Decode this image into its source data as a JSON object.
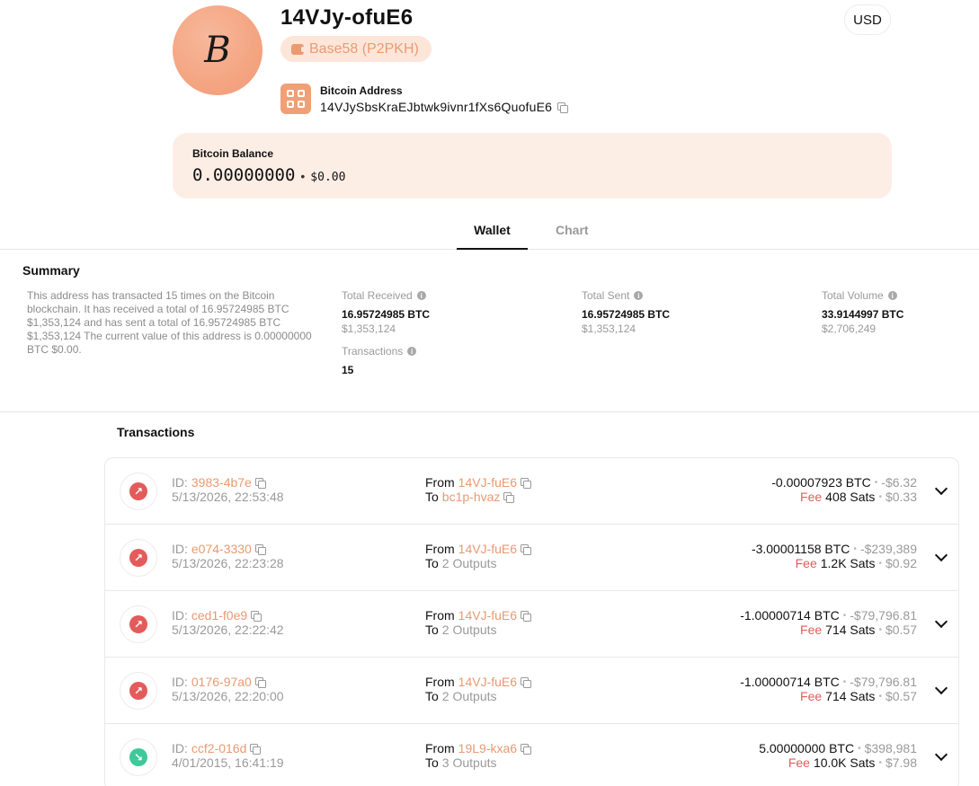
{
  "header": {
    "avatar_symbol": "B",
    "title": "14VJy-ofuE6",
    "address_type": "Base58 (P2PKH)",
    "address_label": "Bitcoin Address",
    "address_value": "14VJySbsKraEJbtwk9ivnr1fXs6QuofuE6",
    "currency": "USD"
  },
  "balance": {
    "label": "Bitcoin Balance",
    "btc": "0.00000000",
    "separator": "•",
    "usd": "$0.00"
  },
  "tabs": [
    {
      "label": "Wallet",
      "active": true
    },
    {
      "label": "Chart",
      "active": false
    }
  ],
  "summary": {
    "title": "Summary",
    "text": "This address has transacted 15 times on the Bitcoin blockchain. It has received a total of 16.95724985 BTC $1,353,124 and has sent a total of 16.95724985 BTC $1,353,124 The current value of this address is 0.00000000 BTC $0.00.",
    "stats": {
      "received": {
        "label": "Total Received",
        "value": "16.95724985 BTC",
        "sub": "$1,353,124"
      },
      "sent": {
        "label": "Total Sent",
        "value": "16.95724985 BTC",
        "sub": "$1,353,124"
      },
      "volume": {
        "label": "Total Volume",
        "value": "33.9144997 BTC",
        "sub": "$2,706,249"
      },
      "transactions": {
        "label": "Transactions",
        "value": "15"
      }
    }
  },
  "transactions": {
    "title": "Transactions",
    "id_prefix": "ID:",
    "from_prefix": "From",
    "to_prefix": "To",
    "fee_word": "Fee",
    "sep": "•",
    "rows": [
      {
        "direction": "out",
        "id": "3983-4b7e",
        "date": "5/13/2026, 22:53:48",
        "from": "14VJ-fuE6",
        "to": "bc1p-hvaz",
        "to_is_link": true,
        "amount_btc": "-0.00007923 BTC",
        "amount_usd": "-$6.32",
        "fee_sats": "408 Sats",
        "fee_usd": "$0.33"
      },
      {
        "direction": "out",
        "id": "e074-3330",
        "date": "5/13/2026, 22:23:28",
        "from": "14VJ-fuE6",
        "to": "2 Outputs",
        "to_is_link": false,
        "amount_btc": "-3.00001158 BTC",
        "amount_usd": "-$239,389",
        "fee_sats": "1.2K Sats",
        "fee_usd": "$0.92"
      },
      {
        "direction": "out",
        "id": "ced1-f0e9",
        "date": "5/13/2026, 22:22:42",
        "from": "14VJ-fuE6",
        "to": "2 Outputs",
        "to_is_link": false,
        "amount_btc": "-1.00000714 BTC",
        "amount_usd": "-$79,796.81",
        "fee_sats": "714 Sats",
        "fee_usd": "$0.57"
      },
      {
        "direction": "out",
        "id": "0176-97a0",
        "date": "5/13/2026, 22:20:00",
        "from": "14VJ-fuE6",
        "to": "2 Outputs",
        "to_is_link": false,
        "amount_btc": "-1.00000714 BTC",
        "amount_usd": "-$79,796.81",
        "fee_sats": "714 Sats",
        "fee_usd": "$0.57"
      },
      {
        "direction": "in",
        "id": "ccf2-016d",
        "date": "4/01/2015, 16:41:19",
        "from": "19L9-kxa6",
        "to": "3 Outputs",
        "to_is_link": false,
        "amount_btc": "5.00000000 BTC",
        "amount_usd": "$398,981",
        "fee_sats": "10.0K Sats",
        "fee_usd": "$7.98"
      }
    ]
  },
  "icons": {
    "outgoing": "arrow-up-right-icon",
    "incoming": "arrow-down-right-icon",
    "copy": "copy-icon",
    "info": "info-icon",
    "expand": "chevron-down-icon"
  },
  "colors": {
    "accent": "#e79a72",
    "avatar": "#f4a582",
    "balance_card": "#fdeee5",
    "outgoing": "#e45b5b",
    "incoming": "#3ec99a"
  }
}
